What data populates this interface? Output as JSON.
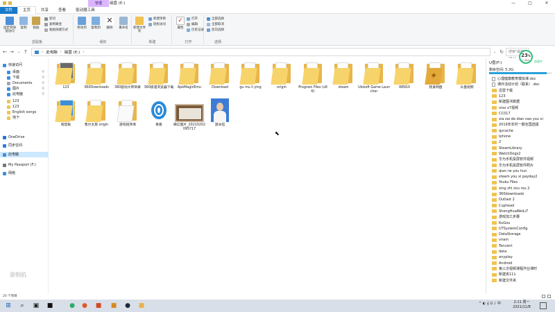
{
  "window": {
    "title": "磁盘 (E:)",
    "context_tab": "管理",
    "controls": [
      "—",
      "□",
      "✕"
    ]
  },
  "ribbon_tabs": [
    "文件",
    "主页",
    "共享",
    "查看",
    "驱动器工具"
  ],
  "ribbon": {
    "clipboard": {
      "group": "剪贴板",
      "pin": "固定到快速访问",
      "copy": "复制",
      "paste": "粘贴",
      "cut": "剪切",
      "copy_path": "复制路径",
      "paste_shortcut": "粘贴快捷方式"
    },
    "organize": {
      "group": "组织",
      "move_to": "移动到",
      "copy_to": "复制到",
      "delete": "删除",
      "rename": "重命名"
    },
    "new": {
      "group": "新建",
      "new_folder": "新建文件夹",
      "new_item": "新建项目",
      "easy_access": "轻松访问"
    },
    "open": {
      "group": "打开",
      "properties": "属性",
      "open": "打开",
      "edit": "编辑",
      "history": "历史记录"
    },
    "select": {
      "group": "选择",
      "select_all": "全部选择",
      "select_none": "全部取消",
      "invert": "反向选择"
    }
  },
  "address": {
    "crumbs": [
      "此电脑",
      "磁盘 (E:)"
    ],
    "search_placeholder": "搜索\"磁盘 (E:)\""
  },
  "nav_pane": [
    {
      "label": "快速访问",
      "icon": "star-icon",
      "color": "#3b8ee0",
      "pin": false,
      "selected": false
    },
    {
      "label": "桌面",
      "icon": "desktop-icon",
      "color": "#3b8ee0",
      "pin": true,
      "selected": false
    },
    {
      "label": "下载",
      "icon": "download-icon",
      "color": "#3b8ee0",
      "pin": true,
      "selected": false
    },
    {
      "label": "Documents",
      "icon": "document-icon",
      "color": "#9aa6b8",
      "pin": true,
      "selected": false
    },
    {
      "label": "图片",
      "icon": "pictures-icon",
      "color": "#3b8ee0",
      "pin": true,
      "selected": false
    },
    {
      "label": "此电脑",
      "icon": "computer-icon",
      "color": "#3b8ee0",
      "pin": true,
      "selected": false
    },
    {
      "label": "123",
      "icon": "folder-icon",
      "color": "#f0c350",
      "pin": false,
      "selected": false
    },
    {
      "label": "123",
      "icon": "folder-icon",
      "color": "#f0c350",
      "pin": false,
      "selected": false
    },
    {
      "label": "English songs",
      "icon": "folder-icon",
      "color": "#f0c350",
      "pin": false,
      "selected": false
    },
    {
      "label": "地下",
      "icon": "folder-icon",
      "color": "#f0c350",
      "pin": false,
      "selected": false
    },
    {
      "label": "OneDrive",
      "icon": "cloud-icon",
      "color": "#1f78d1",
      "pin": false,
      "selected": false
    },
    {
      "label": "同步空间",
      "icon": "sync-icon",
      "color": "#2a7de1",
      "pin": false,
      "selected": false
    },
    {
      "label": "此电脑",
      "icon": "computer-icon",
      "color": "#3b8ee0",
      "pin": false,
      "selected": true
    },
    {
      "label": "My Passport (F:)",
      "icon": "drive-icon",
      "color": "#777",
      "pin": false,
      "selected": false
    },
    {
      "label": "网络",
      "icon": "network-icon",
      "color": "#3b8ee0",
      "pin": false,
      "selected": false
    }
  ],
  "files": [
    {
      "name": "123",
      "kind": "folder-image"
    },
    {
      "name": "360Downloads",
      "kind": "folder"
    },
    {
      "name": "360驱动大师目录",
      "kind": "folder"
    },
    {
      "name": "360极速浏览器下载",
      "kind": "folder"
    },
    {
      "name": "ApkMagicEmu",
      "kind": "folder"
    },
    {
      "name": "Download",
      "kind": "folder"
    },
    {
      "name": "gu mu li ying",
      "kind": "folder"
    },
    {
      "name": "origin",
      "kind": "folder"
    },
    {
      "name": "Program Files (x86)",
      "kind": "folder"
    },
    {
      "name": "steam",
      "kind": "folder"
    },
    {
      "name": "Ubisoft Game Launcher",
      "kind": "folder"
    },
    {
      "name": "WIN10",
      "kind": "folder"
    },
    {
      "name": "我爱网盘",
      "kind": "folder-app"
    },
    {
      "name": "头盘视频",
      "kind": "folder"
    },
    {
      "name": "铭瑄板",
      "kind": "folder-blue"
    },
    {
      "name": "鲁尔太旅 origin",
      "kind": "folder"
    },
    {
      "name": "游戏程序库",
      "kind": "folder-doc"
    },
    {
      "name": "看看",
      "kind": "app-swirl"
    },
    {
      "name": "微信图片_20210202095717",
      "kind": "image-card"
    },
    {
      "name": "游泳馆",
      "kind": "image-photo"
    }
  ],
  "preview": {
    "title": "U盘(F:)",
    "free": "剩余空间: 5.3G",
    "usage_fraction": 0.92,
    "items": [
      {
        "label": "心理健康教育模拟课.doc",
        "doc": true
      },
      {
        "label": "课外活动计划（联系）.doc",
        "doc": true
      },
      {
        "label": "迅雷下载",
        "doc": false
      },
      {
        "label": "123",
        "doc": false
      },
      {
        "label": "新建图书数据",
        "doc": false
      },
      {
        "label": "vivo x7视频",
        "doc": false
      },
      {
        "label": "CC017",
        "doc": false
      },
      {
        "label": "xia zai de dian nao you xi",
        "doc": false
      },
      {
        "label": "2019年农村一期全国选拔",
        "doc": false
      },
      {
        "label": "qycache",
        "doc": false
      },
      {
        "label": "iphone",
        "doc": false
      },
      {
        "label": "2",
        "doc": false
      },
      {
        "label": "SteamLibrary",
        "doc": false
      },
      {
        "label": "WatchDogs2",
        "doc": false
      },
      {
        "label": "华为手机投屏软件视频",
        "doc": false
      },
      {
        "label": "华为手机投屏软件照片",
        "doc": false
      },
      {
        "label": "qian rw you hun",
        "doc": false
      },
      {
        "label": "steam you xi payday2",
        "doc": false
      },
      {
        "label": "Youku Files",
        "doc": false
      },
      {
        "label": "xing zhi zou rou 2",
        "doc": false
      },
      {
        "label": "360downloads",
        "doc": false
      },
      {
        "label": "Outlast 2",
        "doc": false
      },
      {
        "label": "Cuphead",
        "doc": false
      },
      {
        "label": "ShengHuaWeiLi7",
        "doc": false
      },
      {
        "label": "游戏加工步骤",
        "doc": false
      },
      {
        "label": "KuGou",
        "doc": false
      },
      {
        "label": "UTSystemConfig",
        "doc": false
      },
      {
        "label": "DataStorage",
        "doc": false
      },
      {
        "label": "vnam",
        "doc": false
      },
      {
        "label": "Tencent",
        "doc": false
      },
      {
        "label": "data",
        "doc": false
      },
      {
        "label": "anyplay",
        "doc": false
      },
      {
        "label": "Android",
        "doc": false
      },
      {
        "label": "第三次视频课程作业课时",
        "doc": false
      },
      {
        "label": "新建夹111",
        "doc": false
      },
      {
        "label": "新建文件夹",
        "doc": false
      }
    ]
  },
  "perf": {
    "value": "23",
    "unit": "%",
    "sub": "1.4K/s",
    "label": "加速中"
  },
  "statusbar": "20 个项目",
  "taskbar": {
    "icons": [
      {
        "name": "start-icon",
        "glyph": "⊞",
        "color": "#1a5fb4"
      },
      {
        "name": "search-icon",
        "glyph": "⌕",
        "color": "#222"
      },
      {
        "name": "task-view-icon",
        "glyph": "▣",
        "color": "#222"
      },
      {
        "name": "media-app-icon",
        "glyph": "■",
        "color": "#111"
      },
      {
        "name": "wechat-icon",
        "glyph": "●",
        "color": "#2aae67"
      },
      {
        "name": "browser-icon",
        "glyph": "●",
        "color": "#e0582b"
      },
      {
        "name": "ppt-icon",
        "glyph": "■",
        "color": "#d24726"
      },
      {
        "name": "game-icon",
        "glyph": "■",
        "color": "#d8891f"
      },
      {
        "name": "steam-icon",
        "glyph": "●",
        "color": "#1b2838"
      },
      {
        "name": "file-explorer-icon",
        "glyph": "■",
        "color": "#e7b24a"
      }
    ],
    "tray": "^ ◐ 𝄞 ⊡ ♪ 中",
    "time": "2:11 周一",
    "date": "2021/11/8"
  },
  "watermark": "录制机"
}
